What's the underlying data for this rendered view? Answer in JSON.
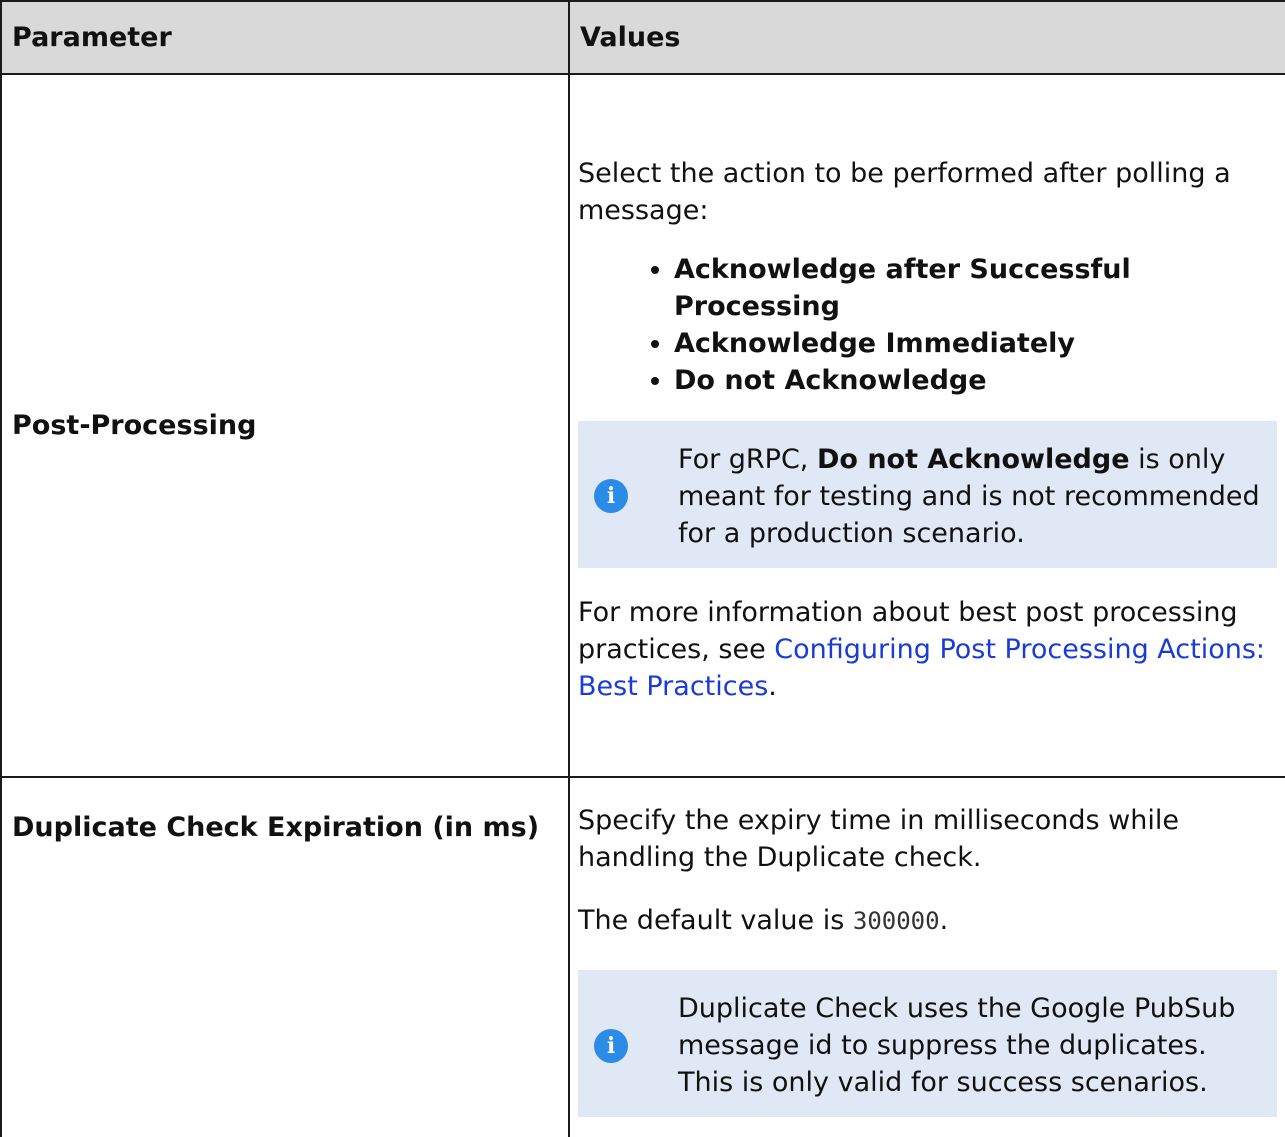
{
  "header": {
    "parameter": "Parameter",
    "values": "Values"
  },
  "rows": [
    {
      "parameter": "Post-Processing",
      "intro": "Select the action to be performed after polling a message:",
      "options": [
        "Acknowledge after Successful Processing",
        "Acknowledge Immediately",
        "Do not Acknowledge"
      ],
      "note": {
        "icon": "info-icon",
        "before": "For gRPC, ",
        "bold": "Do not Acknowledge",
        "after": " is only meant for testing and is not recommended for a production scenario."
      },
      "more_before": "For more information about best post processing practices, see ",
      "more_link": "Configuring Post Processing Actions: Best Practices",
      "more_after": "."
    },
    {
      "parameter": "Duplicate Check Expiration (in ms)",
      "desc": "Specify the expiry time in milliseconds while handling the Duplicate check.",
      "default_before": "The default value is ",
      "default_value": "300000",
      "default_after": ".",
      "note": {
        "icon": "info-icon",
        "text": "Duplicate Check uses the Google PubSub message id to suppress the duplicates. This is only valid for success scenarios."
      }
    }
  ],
  "colors": {
    "header_bg": "#d9d9d9",
    "note_bg": "#dfe8f4",
    "info_icon": "#2b8ce8",
    "link": "#1a3bd8"
  }
}
